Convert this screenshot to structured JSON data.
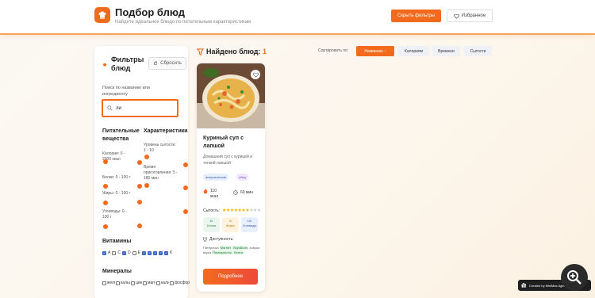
{
  "header": {
    "title": "Подбор блюд",
    "subtitle": "Найдите идеальное блюдо по питательным характеристикам",
    "hide_filters": "Скрыть фильтры",
    "favorites": "Избранное"
  },
  "filters": {
    "title": "Фильтры блюд",
    "reset": "Сбросить",
    "search_label": "Поиск по названию или ингредиенту",
    "search_value": "ли",
    "nutrients_title": "Питательные вещества",
    "nutrients": [
      {
        "label": "Калории: 0 - 2000 ккал"
      },
      {
        "label": "Белки: 0 - 100 г"
      },
      {
        "label": "Жиры: 0 - 100 г"
      },
      {
        "label": "Углеводы: 0 - 100 г"
      }
    ],
    "characteristics_title": "Характеристики",
    "characteristics": [
      {
        "label": "Уровень сытости: 1 - 10"
      },
      {
        "label": "Время приготовления: 5 - 180 мин"
      }
    ],
    "vitamins_title": "Витамины",
    "vitamins": [
      {
        "label": "A",
        "checked": true
      },
      {
        "label": "C",
        "checked": false
      },
      {
        "label": "D",
        "checked": true
      },
      {
        "label": "E",
        "checked": false
      },
      {
        "label": "B1",
        "checked": true
      },
      {
        "label": "B2",
        "checked": true
      },
      {
        "label": "B6",
        "checked": true
      },
      {
        "label": "B12",
        "checked": true
      },
      {
        "label": "K",
        "checked": true
      }
    ],
    "minerals_title": "Минералы",
    "minerals": [
      {
        "label": "железо"
      },
      {
        "label": "кальций"
      },
      {
        "label": "цинк"
      },
      {
        "label": "магний"
      },
      {
        "label": "калий"
      },
      {
        "label": "фосфор"
      }
    ]
  },
  "results": {
    "title": "Найдено блюд:",
    "count": "1",
    "sort_label": "Сортировать по:",
    "sort_options": [
      {
        "label": "Названию ↑",
        "active": true
      },
      {
        "label": "Калориям",
        "active": false
      },
      {
        "label": "Времени",
        "active": false
      },
      {
        "label": "Сытости",
        "active": false
      }
    ]
  },
  "card": {
    "title": "Куриный суп с лапшой",
    "description": "Домашний суп с курицей и тонкой лапшой",
    "tags": [
      "американская",
      "обед"
    ],
    "calories": "110 ккал",
    "time": "60 мин",
    "satiety_label": "Сытость:",
    "rating": 7,
    "rating_max": 10,
    "nutrients": [
      {
        "value": "8г",
        "label": "Белки"
      },
      {
        "value": "4г",
        "label": "Жиры"
      },
      {
        "value": "10г",
        "label": "Углеводы"
      }
    ],
    "availability_label": "Доступность:",
    "shops_prefix": "Пятерочка",
    "shops_hl1": "Магнит",
    "shops_mid": "",
    "shops_hl2": "ВкусВилл",
    "shops_rest": "Азбука вкуса",
    "shops_hl3": "Перекресток",
    "shops_tail": "Лента",
    "more_button": "Подробнее"
  },
  "badge": {
    "text": "Created by MiniMax Agent"
  },
  "colors": {
    "accent": "#f26b1d",
    "checkbox": "#3866c7"
  }
}
